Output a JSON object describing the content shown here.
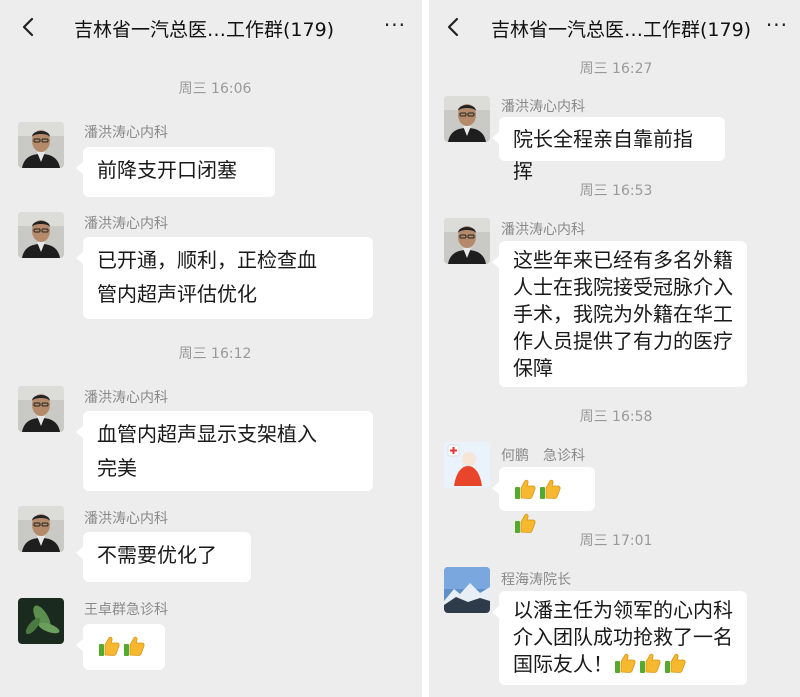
{
  "left_panel": {
    "title": "吉林省一汽总医…工作群(179)",
    "more": "···",
    "items": {
      "t1": "周三 16:06",
      "m1": {
        "sender": "潘洪涛心内科",
        "text": "前降支开口闭塞"
      },
      "m2": {
        "sender": "潘洪涛心内科",
        "line1": "已开通，顺利，正检查血",
        "line2": "管内超声评估优化"
      },
      "t2": "周三 16:12",
      "m3": {
        "sender": "潘洪涛心内科",
        "line1": "血管内超声显示支架植入",
        "line2": "完美"
      },
      "m4": {
        "sender": "潘洪涛心内科",
        "text": "不需要优化了"
      },
      "m5": {
        "sender": "王卓群急诊科",
        "thumbs": 2
      }
    }
  },
  "right_panel": {
    "title": "吉林省一汽总医…工作群(179)",
    "more": "···",
    "items": {
      "t1": "周三 16:27",
      "m1": {
        "sender": "潘洪涛心内科",
        "text": "院长全程亲自靠前指挥"
      },
      "t2": "周三 16:53",
      "m2": {
        "sender": "潘洪涛心内科",
        "line1": "这些年来已经有多名外籍",
        "line2": "人士在我院接受冠脉介入",
        "line3": "手术，我院为外籍在华工",
        "line4": "作人员提供了有力的医疗",
        "line5": "保障"
      },
      "t3": "周三 16:58",
      "m3": {
        "sender": "何鹏　急诊科",
        "thumbs": 3
      },
      "t4": "周三 17:01",
      "m4": {
        "sender": "程海涛院长",
        "line1": "以潘主任为领军的心内科",
        "line2": "介入团队成功抢救了一名",
        "line3": "国际友人！",
        "thumbs": 3
      }
    }
  },
  "icons": {
    "back": "chevron-left-icon",
    "more": "more-dots-icon",
    "thumb": "thumbs-up-emoji"
  },
  "colors": {
    "chat_background": "#ededed",
    "bubble": "#ffffff",
    "timestamp": "#9a9a9a",
    "sender_name": "#8a8a8a",
    "thumb_yellow": "#f5b82e",
    "thumb_green": "#56a92f"
  }
}
